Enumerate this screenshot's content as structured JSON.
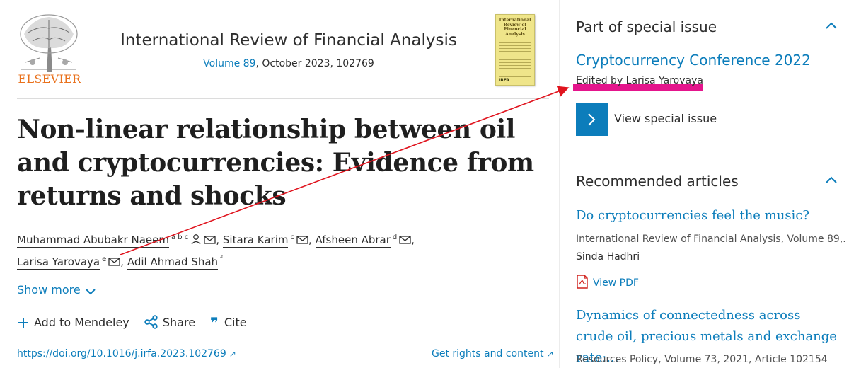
{
  "header": {
    "publisher": "ELSEVIER",
    "journal_title": "International Review of Financial Analysis",
    "volume_link": "Volume 89",
    "issue_info": ", October 2023, 102769",
    "cover_title": "International Review of Financial Analysis",
    "cover_logo": "IRFA"
  },
  "article": {
    "title": "Non-linear relationship between oil and cryptocurrencies: Evidence from returns and shocks",
    "authors": [
      {
        "name": "Muhammad Abubakr Naeem",
        "affil": "a b c",
        "suffix": ","
      },
      {
        "name": "Sitara Karim",
        "affil": "c",
        "suffix": ","
      },
      {
        "name": "Afsheen Abrar",
        "affil": "d",
        "suffix": ","
      },
      {
        "name": "Larisa Yarovaya",
        "affil": "e",
        "suffix": ","
      },
      {
        "name": "Adil Ahmad Shah",
        "affil": "f",
        "suffix": ""
      }
    ],
    "show_more": "Show more",
    "actions": {
      "mendeley": "Add to Mendeley",
      "share": "Share",
      "cite": "Cite"
    },
    "doi": "https://doi.org/10.1016/j.irfa.2023.102769",
    "rights": "Get rights and content"
  },
  "sidebar": {
    "special_issue": {
      "heading": "Part of special issue",
      "name": "Cryptocurrency Conference 2022",
      "edited_by": "Edited by Larisa Yarovaya",
      "view_label": "View special issue"
    },
    "recommended": {
      "heading": "Recommended articles",
      "items": [
        {
          "title": "Do cryptocurrencies feel the music?",
          "meta": "International Review of Financial Analysis, Volume 89,...",
          "author": "Sinda Hadhri",
          "pdf": "View PDF"
        },
        {
          "title": "Dynamics of connectedness across crude oil, precious metals and exchange rate:...",
          "meta": "Resources Policy, Volume 73, 2021, Article 102154"
        }
      ]
    }
  },
  "colors": {
    "link": "#0c7dbb",
    "brand": "#e9711c",
    "highlight": "#e4158c",
    "annotation": "#e0141e"
  }
}
